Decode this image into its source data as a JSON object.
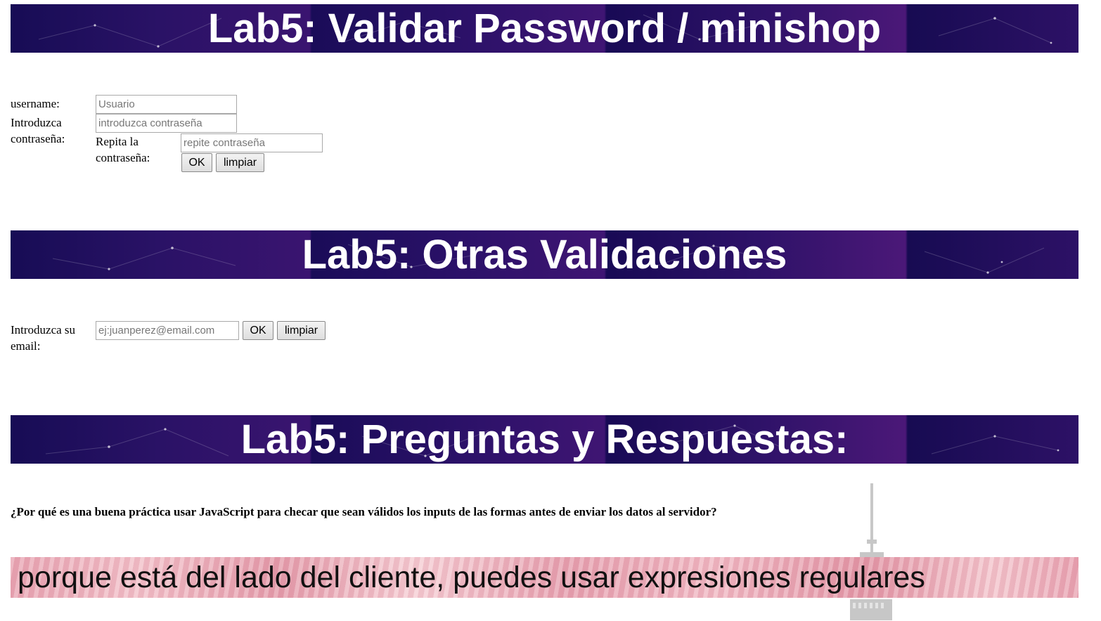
{
  "sections": {
    "password_title": "Lab5: Validar Password / minishop",
    "other_title": "Lab5: Otras Validaciones",
    "qa_title": "Lab5: Preguntas y Respuestas:"
  },
  "password_form": {
    "username_label": "username:",
    "username_placeholder": "Usuario",
    "password_label": "Introduzca contraseña:",
    "password_placeholder": "introduzca contraseña",
    "repeat_label": "Repita la contraseña:",
    "repeat_placeholder": "repite contraseña",
    "ok_label": "OK",
    "clear_label": "limpiar"
  },
  "email_form": {
    "email_label": "Introduzca su email:",
    "email_placeholder": "ej:juanperez@email.com",
    "ok_label": "OK",
    "clear_label": "limpiar"
  },
  "qa": {
    "question": "¿Por qué es una buena práctica usar JavaScript para checar que sean válidos los inputs de las formas antes de enviar los datos al servidor?",
    "answer": "porque está del lado del cliente, puedes usar expresiones regulares"
  },
  "colors": {
    "banner_dark": "#170c55",
    "banner_purple": "#4b1878",
    "answer_pink": "#f1bcc6"
  }
}
